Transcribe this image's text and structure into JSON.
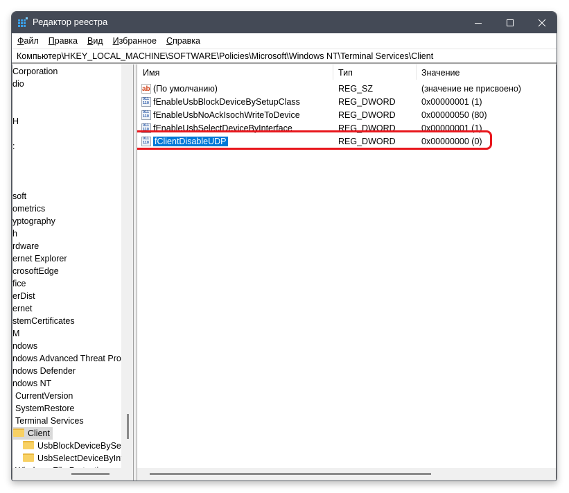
{
  "window": {
    "title": "Редактор реестра",
    "controls": {
      "minimize": "—",
      "maximize": "☐",
      "close": "✕"
    }
  },
  "menu": [
    {
      "accel": "Ф",
      "rest": "айл"
    },
    {
      "accel": "П",
      "rest": "равка"
    },
    {
      "accel": "В",
      "rest": "ид"
    },
    {
      "accel": "И",
      "rest": "збранное"
    },
    {
      "accel": "С",
      "rest": "правка"
    }
  ],
  "address": "Компьютер\\HKEY_LOCAL_MACHINE\\SOFTWARE\\Policies\\Microsoft\\Windows NT\\Terminal Services\\Client",
  "tree": {
    "items": [
      "Corporation",
      "dio",
      "",
      "",
      "H",
      "",
      ":",
      "",
      "",
      "",
      "soft",
      "ometrics",
      "yptography",
      "h",
      "rdware",
      "ernet Explorer",
      "crosoftEdge",
      "fice",
      "erDist",
      "ernet",
      "stemCertificates",
      "M",
      "ndows",
      "ndows Advanced Threat Prote",
      "ndows Defender",
      "ndows NT",
      "CurrentVersion",
      "SystemRestore",
      "Terminal Services",
      "Client",
      "UsbBlockDeviceBySetu",
      "UsbSelectDeviceByInter",
      "Windows File Protection"
    ],
    "selected": "Client"
  },
  "list": {
    "columns": {
      "name": "Имя",
      "type": "Тип",
      "value": "Значение"
    },
    "rows": [
      {
        "icon": "string-value-icon",
        "name": "(По умолчанию)",
        "type": "REG_SZ",
        "value": "(значение не присвоено)"
      },
      {
        "icon": "dword-value-icon",
        "name": "fEnableUsbBlockDeviceBySetupClass",
        "type": "REG_DWORD",
        "value": "0x00000001 (1)"
      },
      {
        "icon": "dword-value-icon",
        "name": "fEnableUsbNoAckIsochWriteToDevice",
        "type": "REG_DWORD",
        "value": "0x00000050 (80)"
      },
      {
        "icon": "dword-value-icon",
        "name": "fEnableUsbSelectDeviceByInterface",
        "type": "REG_DWORD",
        "value": "0x00000001 (1)"
      },
      {
        "icon": "dword-value-icon",
        "name": "fClientDisableUDP",
        "type": "REG_DWORD",
        "value": "0x00000000 (0)",
        "selected": true
      }
    ]
  },
  "annotation": {
    "highlight_color": "#e8171d",
    "target_row": "fClientDisableUDP"
  },
  "colors": {
    "titlebar": "#444a56",
    "selection": "#0078d7"
  }
}
